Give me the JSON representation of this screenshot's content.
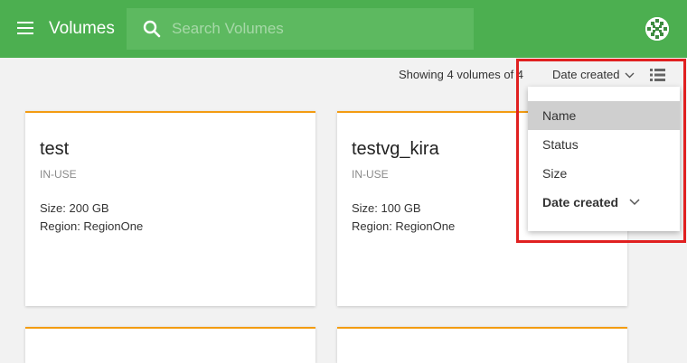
{
  "header": {
    "title": "Volumes",
    "search_placeholder": "Search Volumes",
    "brand_color": "#4caf50"
  },
  "toolbar": {
    "count_text": "Showing 4 volumes of 4",
    "sort_label": "Date created"
  },
  "cards": [
    {
      "title": "test",
      "status": "IN-USE",
      "size": "Size: 200 GB",
      "region": "Region: RegionOne"
    },
    {
      "title": "testvg_kira",
      "status": "IN-USE",
      "size": "Size: 100 GB",
      "region": "Region: RegionOne"
    }
  ],
  "sort_menu": {
    "items": [
      {
        "label": "Name"
      },
      {
        "label": "Status"
      },
      {
        "label": "Size"
      },
      {
        "label": "Date created"
      }
    ]
  },
  "icons": [
    "menu-icon",
    "search-icon",
    "avatar",
    "chevron-down-icon",
    "list-view-icon"
  ],
  "colors": {
    "card_accent": "#f39c12",
    "highlight": "#e02020"
  }
}
